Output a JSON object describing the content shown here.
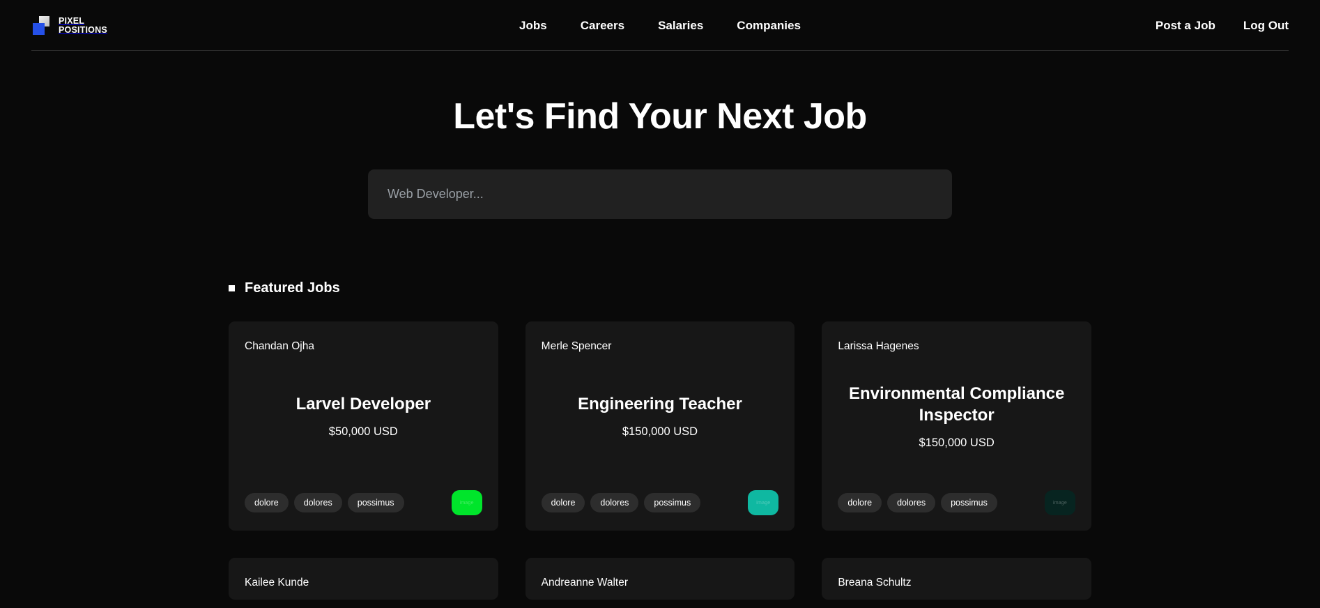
{
  "header": {
    "brand": {
      "line1": "PIXEL",
      "line2": "POSITIONS"
    },
    "nav_center": [
      {
        "label": "Jobs"
      },
      {
        "label": "Careers"
      },
      {
        "label": "Salaries"
      },
      {
        "label": "Companies"
      }
    ],
    "nav_right": [
      {
        "label": "Post a Job"
      },
      {
        "label": "Log Out"
      }
    ]
  },
  "hero": {
    "title": "Let's Find Your Next Job",
    "search_placeholder": "Web Developer...",
    "search_value": ""
  },
  "featured": {
    "section_title": "Featured Jobs",
    "bullet_icon": "square-bullet-icon",
    "cards": [
      {
        "employer": "Chandan Ojha",
        "role": "Larvel Developer",
        "salary": "$50,000 USD",
        "tags": [
          "dolore",
          "dolores",
          "possimus"
        ],
        "thumb_color": "#00e52b",
        "thumb_alt": "image"
      },
      {
        "employer": "Merle Spencer",
        "role": "Engineering Teacher",
        "salary": "$150,000 USD",
        "tags": [
          "dolore",
          "dolores",
          "possimus"
        ],
        "thumb_color": "#0fb8a1",
        "thumb_alt": "image"
      },
      {
        "employer": "Larissa Hagenes",
        "role": "Environmental Compliance Inspector",
        "salary": "$150,000 USD",
        "tags": [
          "dolore",
          "dolores",
          "possimus"
        ],
        "thumb_color": "#072420",
        "thumb_alt": "image"
      }
    ],
    "cards_row_two": [
      {
        "employer": "Kailee Kunde"
      },
      {
        "employer": "Andreanne Walter"
      },
      {
        "employer": "Breana Schultz"
      }
    ]
  },
  "colors": {
    "page_background": "#090909",
    "card_background": "#171717",
    "input_background": "#212121",
    "tag_background": "#2d2d2d",
    "brand_blue": "#2550e8",
    "divider": "#2e2e2e"
  }
}
